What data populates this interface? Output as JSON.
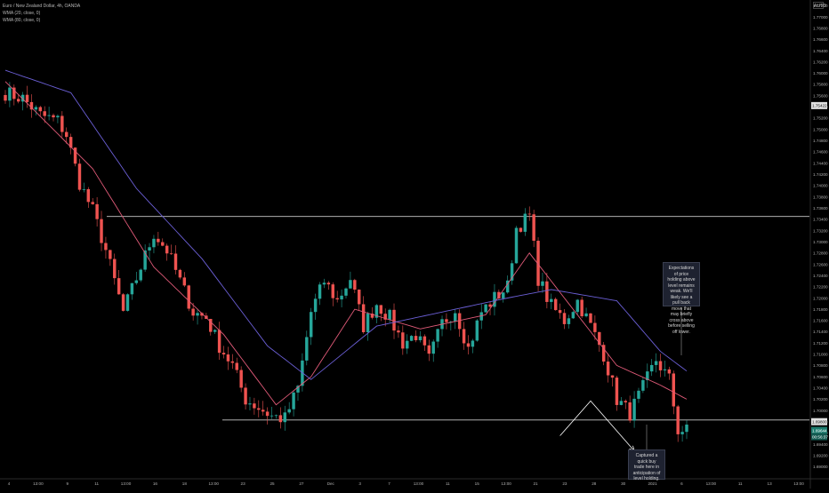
{
  "legend": {
    "symbol_line": "Euro / New Zealand Dollar, 4h, OANDA",
    "ma1_line": "WMA (20, close, 0)",
    "ma2_line": "WMA (80, close, 0)"
  },
  "corner_button": "AUTO",
  "notes": {
    "upper": "Expectations of price holding above level remains weak. We'll likely see a pull back move that may briefly cross above before selling off lower.",
    "lower": "Captured a quick buy trade here in anticipation of level holding."
  },
  "colors": {
    "up": "#26a69a",
    "down": "#ef5350",
    "wma20": "#e05a78",
    "wma80": "#6b5fd6",
    "level_line": "#c9c9c9",
    "arrow": "#ffffff"
  },
  "chart_data": {
    "type": "candlestick",
    "symbol": "EURNZD",
    "timeframe": "4h",
    "y_ticks": [
      "1.77200",
      "1.77000",
      "1.76800",
      "1.76600",
      "1.76400",
      "1.76200",
      "1.76000",
      "1.75800",
      "1.75600",
      "1.75400",
      "1.75200",
      "1.75000",
      "1.74800",
      "1.74600",
      "1.74400",
      "1.74200",
      "1.74000",
      "1.73800",
      "1.73600",
      "1.73400",
      "1.73200",
      "1.73000",
      "1.72800",
      "1.72600",
      "1.72400",
      "1.72200",
      "1.72000",
      "1.71800",
      "1.71600",
      "1.71400",
      "1.71200",
      "1.71000",
      "1.70800",
      "1.70600",
      "1.70400",
      "1.70200",
      "1.70000",
      "1.69800",
      "1.69600",
      "1.69400",
      "1.69200",
      "1.69000",
      "1.68800"
    ],
    "ylim": [
      1.688,
      1.773
    ],
    "x_ticks": [
      "4",
      "13:00",
      "9",
      "11",
      "13:00",
      "16",
      "18",
      "13:00",
      "23",
      "25",
      "27",
      "Dec",
      "3",
      "7",
      "13:00",
      "11",
      "15",
      "13:00",
      "21",
      "23",
      "28",
      "30",
      "2021",
      "6",
      "13:00",
      "11",
      "13",
      "13:00"
    ],
    "price_badges": [
      {
        "label": "1.75422",
        "value": 1.75422,
        "style": "light"
      },
      {
        "label": "1.69800",
        "value": 1.698,
        "style": "light"
      },
      {
        "label": "1.69644",
        "value": 1.69644,
        "style": "current"
      },
      {
        "label": "00:56:37",
        "value": 1.69644,
        "style": "timer"
      }
    ],
    "levels": [
      {
        "name": "resistance",
        "value": 1.7345
      },
      {
        "name": "support",
        "value": 1.6983
      }
    ],
    "projection": [
      {
        "bar": 127,
        "value": 1.6955
      },
      {
        "bar": 134,
        "value": 1.7017
      },
      {
        "bar": 144,
        "value": 1.6928
      }
    ],
    "close_path": [
      [
        0,
        1.7565
      ],
      [
        4,
        1.7555
      ],
      [
        8,
        1.7525
      ],
      [
        12,
        1.7515
      ],
      [
        14,
        1.749
      ],
      [
        17,
        1.7405
      ],
      [
        20,
        1.7355
      ],
      [
        23,
        1.7285
      ],
      [
        27,
        1.7175
      ],
      [
        30,
        1.7235
      ],
      [
        34,
        1.7315
      ],
      [
        37,
        1.7285
      ],
      [
        40,
        1.723
      ],
      [
        43,
        1.7175
      ],
      [
        46,
        1.7165
      ],
      [
        49,
        1.7115
      ],
      [
        52,
        1.708
      ],
      [
        55,
        1.702
      ],
      [
        58,
        1.7005
      ],
      [
        61,
        1.699
      ],
      [
        64,
        1.6985
      ],
      [
        67,
        1.704
      ],
      [
        70,
        1.7175
      ],
      [
        73,
        1.723
      ],
      [
        76,
        1.7195
      ],
      [
        79,
        1.7235
      ],
      [
        82,
        1.715
      ],
      [
        85,
        1.719
      ],
      [
        88,
        1.7165
      ],
      [
        91,
        1.712
      ],
      [
        94,
        1.7135
      ],
      [
        97,
        1.709
      ],
      [
        100,
        1.7155
      ],
      [
        103,
        1.718
      ],
      [
        106,
        1.711
      ],
      [
        109,
        1.7175
      ],
      [
        112,
        1.72
      ],
      [
        115,
        1.722
      ],
      [
        117,
        1.7325
      ],
      [
        120,
        1.7345
      ],
      [
        122,
        1.7235
      ],
      [
        125,
        1.7185
      ],
      [
        128,
        1.716
      ],
      [
        131,
        1.7195
      ],
      [
        134,
        1.715
      ],
      [
        137,
        1.71
      ],
      [
        140,
        1.702
      ],
      [
        143,
        1.6995
      ],
      [
        146,
        1.704
      ],
      [
        149,
        1.709
      ],
      [
        152,
        1.7055
      ],
      [
        154,
        1.6965
      ],
      [
        156,
        1.6964
      ]
    ],
    "series": [
      {
        "name": "WMA (20, close, 0)",
        "path": [
          [
            0,
            1.7585
          ],
          [
            20,
            1.743
          ],
          [
            34,
            1.7255
          ],
          [
            50,
            1.7135
          ],
          [
            62,
            1.701
          ],
          [
            70,
            1.706
          ],
          [
            80,
            1.718
          ],
          [
            95,
            1.7145
          ],
          [
            110,
            1.717
          ],
          [
            120,
            1.728
          ],
          [
            128,
            1.72
          ],
          [
            140,
            1.708
          ],
          [
            150,
            1.7045
          ],
          [
            156,
            1.702
          ]
        ]
      },
      {
        "name": "WMA (80, close, 0)",
        "path": [
          [
            0,
            1.7605
          ],
          [
            15,
            1.7565
          ],
          [
            30,
            1.7395
          ],
          [
            45,
            1.727
          ],
          [
            60,
            1.7115
          ],
          [
            70,
            1.7055
          ],
          [
            85,
            1.715
          ],
          [
            100,
            1.7175
          ],
          [
            115,
            1.72
          ],
          [
            125,
            1.7215
          ],
          [
            140,
            1.7195
          ],
          [
            150,
            1.7105
          ],
          [
            156,
            1.707
          ]
        ]
      }
    ]
  }
}
